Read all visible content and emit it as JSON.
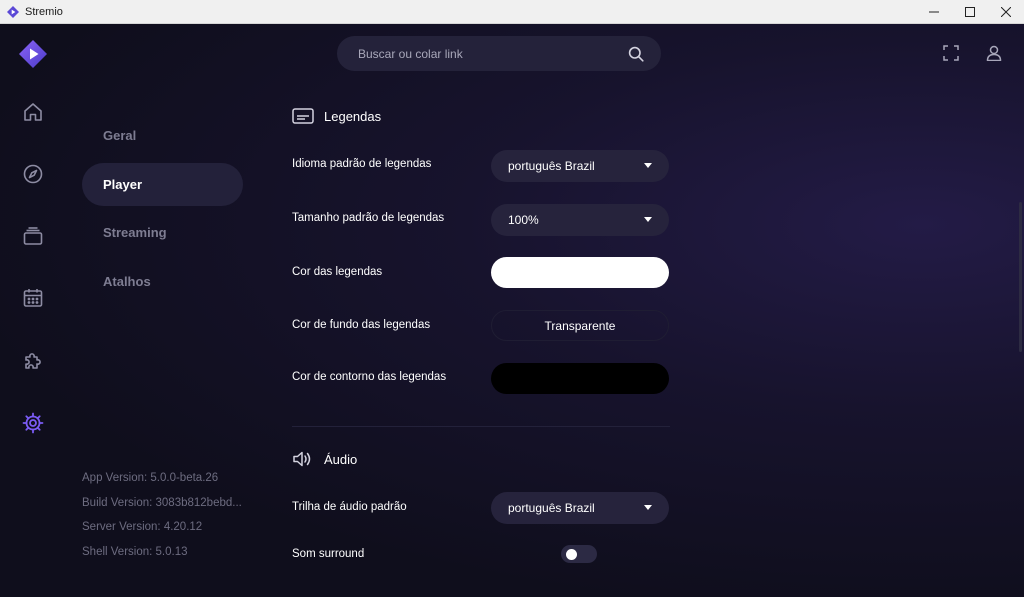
{
  "window": {
    "title": "Stremio"
  },
  "search": {
    "placeholder": "Buscar ou colar link"
  },
  "nav": {
    "items": [
      "home-icon",
      "discover-icon",
      "library-icon",
      "calendar-icon",
      "addons-icon",
      "settings-icon"
    ]
  },
  "settings_menu": {
    "items": [
      "Geral",
      "Player",
      "Streaming",
      "Atalhos"
    ],
    "active": "Player"
  },
  "versions": [
    "App Version: 5.0.0-beta.26",
    "Build Version: 3083b812bebd...",
    "Server Version: 4.20.12",
    "Shell Version: 5.0.13"
  ],
  "subtitles": {
    "title": "Legendas",
    "default_language_label": "Idioma padrão de legendas",
    "default_language_value": "português Brazil",
    "default_size_label": "Tamanho padrão de legendas",
    "default_size_value": "100%",
    "color_label": "Cor das legendas",
    "background_label": "Cor de fundo das legendas",
    "background_value": "Transparente",
    "outline_label": "Cor de contorno das legendas"
  },
  "audio": {
    "title": "Áudio",
    "default_track_label": "Trilha de áudio padrão",
    "default_track_value": "português Brazil",
    "surround_label": "Som surround",
    "surround_enabled": false
  },
  "colors": {
    "accent": "#7b5bf5",
    "subtitle_color": "#ffffff",
    "outline_color": "#000000"
  }
}
